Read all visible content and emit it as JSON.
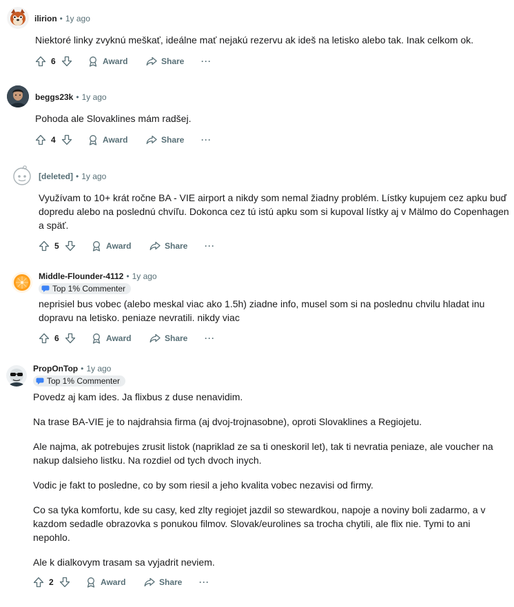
{
  "actions": {
    "award": "Award",
    "share": "Share",
    "more": "···"
  },
  "comments": [
    {
      "author": "ilirion",
      "dot": "•",
      "time": "1y ago",
      "badge": "",
      "body": [
        "Niektoré linky zvyknú meškať, ideálne mať nejakú rezervu ak ideš na letisko alebo tak. Inak celkom ok."
      ],
      "votes": "6"
    },
    {
      "author": "beggs23k",
      "dot": "•",
      "time": "1y ago",
      "badge": "",
      "body": [
        "Pohoda ale Slovaklines mám radšej."
      ],
      "votes": "4"
    },
    {
      "author": "[deleted]",
      "dot": "•",
      "time": "1y ago",
      "badge": "",
      "body": [
        "Využívam to 10+ krát ročne BA - VIE airport a nikdy som nemal žiadny problém. Lístky kupujem cez apku buď dopredu alebo na poslednú chvíľu. Dokonca cez tú istú apku som si kupoval lístky aj v Mälmo do Copenhagen a späť."
      ],
      "votes": "5"
    },
    {
      "author": "Middle-Flounder-4112",
      "dot": "•",
      "time": "1y ago",
      "badge": "Top 1% Commenter",
      "body": [
        "neprisiel bus vobec (alebo meskal viac ako 1.5h) ziadne info, musel som si na poslednu chvilu hladat inu dopravu na letisko. peniaze nevratili. nikdy viac"
      ],
      "votes": "6"
    },
    {
      "author": "PropOnTop",
      "dot": "•",
      "time": "1y ago",
      "badge": "Top 1% Commenter",
      "body": [
        "Povedz aj kam ides. Ja flixbus z duse nenavidim.",
        "Na trase BA-VIE je to najdrahsia firma (aj dvoj-trojnasobne), oproti Slovaklines a Regiojetu.",
        "Ale najma, ak potrebujes zrusit listok (napriklad ze sa ti oneskoril let), tak ti nevratia peniaze, ale voucher na nakup dalsieho listku. Na rozdiel od tych dvoch inych.",
        "Vodic je fakt to posledne, co by som riesil a jeho kvalita vobec nezavisi od firmy.",
        "Co sa tyka komfortu, kde su casy, ked zlty regiojet jazdil so stewardkou, napoje a noviny boli zadarmo, a v kazdom sedadle obrazovka s ponukou filmov. Slovak/eurolines sa trocha chytili, ale flix nie. Tymi to ani nepohlo.",
        "Ale k dialkovym trasam sa vyjadrit neviem."
      ],
      "votes": "2"
    }
  ]
}
